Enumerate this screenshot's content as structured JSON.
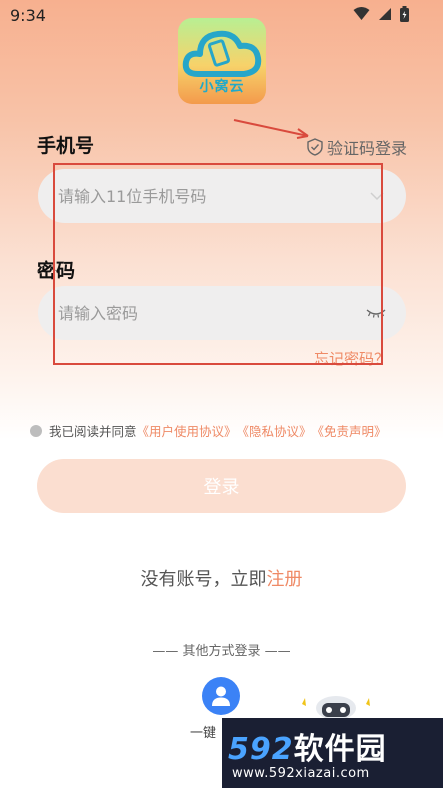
{
  "status_bar": {
    "time": "9:34"
  },
  "logo": {
    "text": "小窝云"
  },
  "phone": {
    "label": "手机号",
    "placeholder": "请输入11位手机号码"
  },
  "code_login": {
    "label": "验证码登录"
  },
  "password": {
    "label": "密码",
    "placeholder": "请输入密码"
  },
  "forgot": {
    "label": "忘记密码？"
  },
  "agreement": {
    "prefix": "我已阅读并同意",
    "user_agreement": "《用户使用协议》",
    "privacy": "《隐私协议》",
    "disclaimer": "《免责声明》"
  },
  "login_button": {
    "label": "登录"
  },
  "register": {
    "prefix": "没有账号，立即",
    "link": "注册"
  },
  "other_login": {
    "label": "—— 其他方式登录 ——"
  },
  "one_key": {
    "label": "一键"
  },
  "watermark": {
    "number": "592",
    "text": "软件园",
    "url": "www.592xiazai.com"
  },
  "colors": {
    "accent": "#ef8a66",
    "annotation": "#d94a3d",
    "one_key_icon": "#3b82f6"
  }
}
